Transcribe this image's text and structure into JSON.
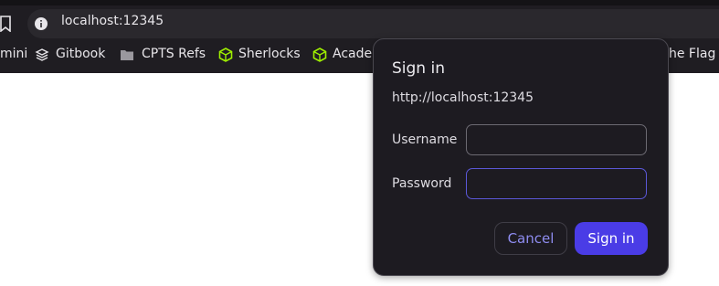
{
  "browser": {
    "url": "localhost:12345",
    "bookmarks": [
      {
        "label": "mini",
        "icon": "none"
      },
      {
        "label": "Gitbook",
        "icon": "gitbook-icon"
      },
      {
        "label": "CPTS Refs",
        "icon": "folder-icon"
      },
      {
        "label": "Sherlocks",
        "icon": "hackthebox-icon"
      },
      {
        "label": "Acade",
        "icon": "hackthebox-icon"
      },
      {
        "label": "he Flag",
        "icon": "none"
      }
    ]
  },
  "dialog": {
    "title": "Sign in",
    "origin": "http://localhost:12345",
    "username_label": "Username",
    "username_value": "",
    "password_label": "Password",
    "password_value": "",
    "cancel_label": "Cancel",
    "signin_label": "Sign in"
  },
  "colors": {
    "accent": "#4a3ce6",
    "dialog_bg": "#1d1b21",
    "chrome_bg": "#1f1d22"
  }
}
